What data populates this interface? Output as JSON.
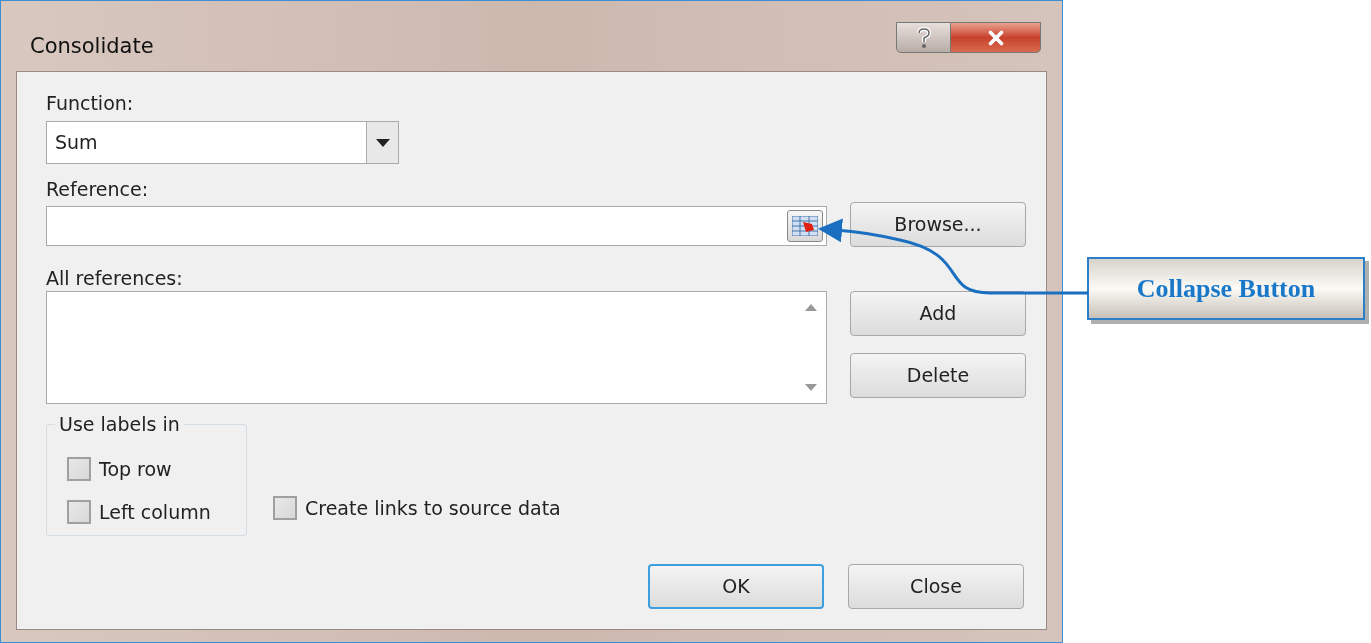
{
  "window": {
    "title": "Consolidate"
  },
  "function": {
    "label": "Function:",
    "value": "Sum"
  },
  "reference": {
    "label": "Reference:"
  },
  "all_references": {
    "label": "All references:"
  },
  "side_buttons": [
    {
      "label": "Browse..."
    },
    {
      "label": "Add"
    },
    {
      "label": "Delete"
    }
  ],
  "labels_group": {
    "title": "Use labels in",
    "checkboxes": [
      {
        "label": "Top row",
        "checked": false
      },
      {
        "label": "Left column",
        "checked": false
      }
    ]
  },
  "create_links": {
    "label": "Create links to source data",
    "checked": false
  },
  "footer_buttons": [
    {
      "label": "OK",
      "default": true
    },
    {
      "label": "Close",
      "default": false
    }
  ],
  "callout": {
    "text": "Collapse Button"
  }
}
